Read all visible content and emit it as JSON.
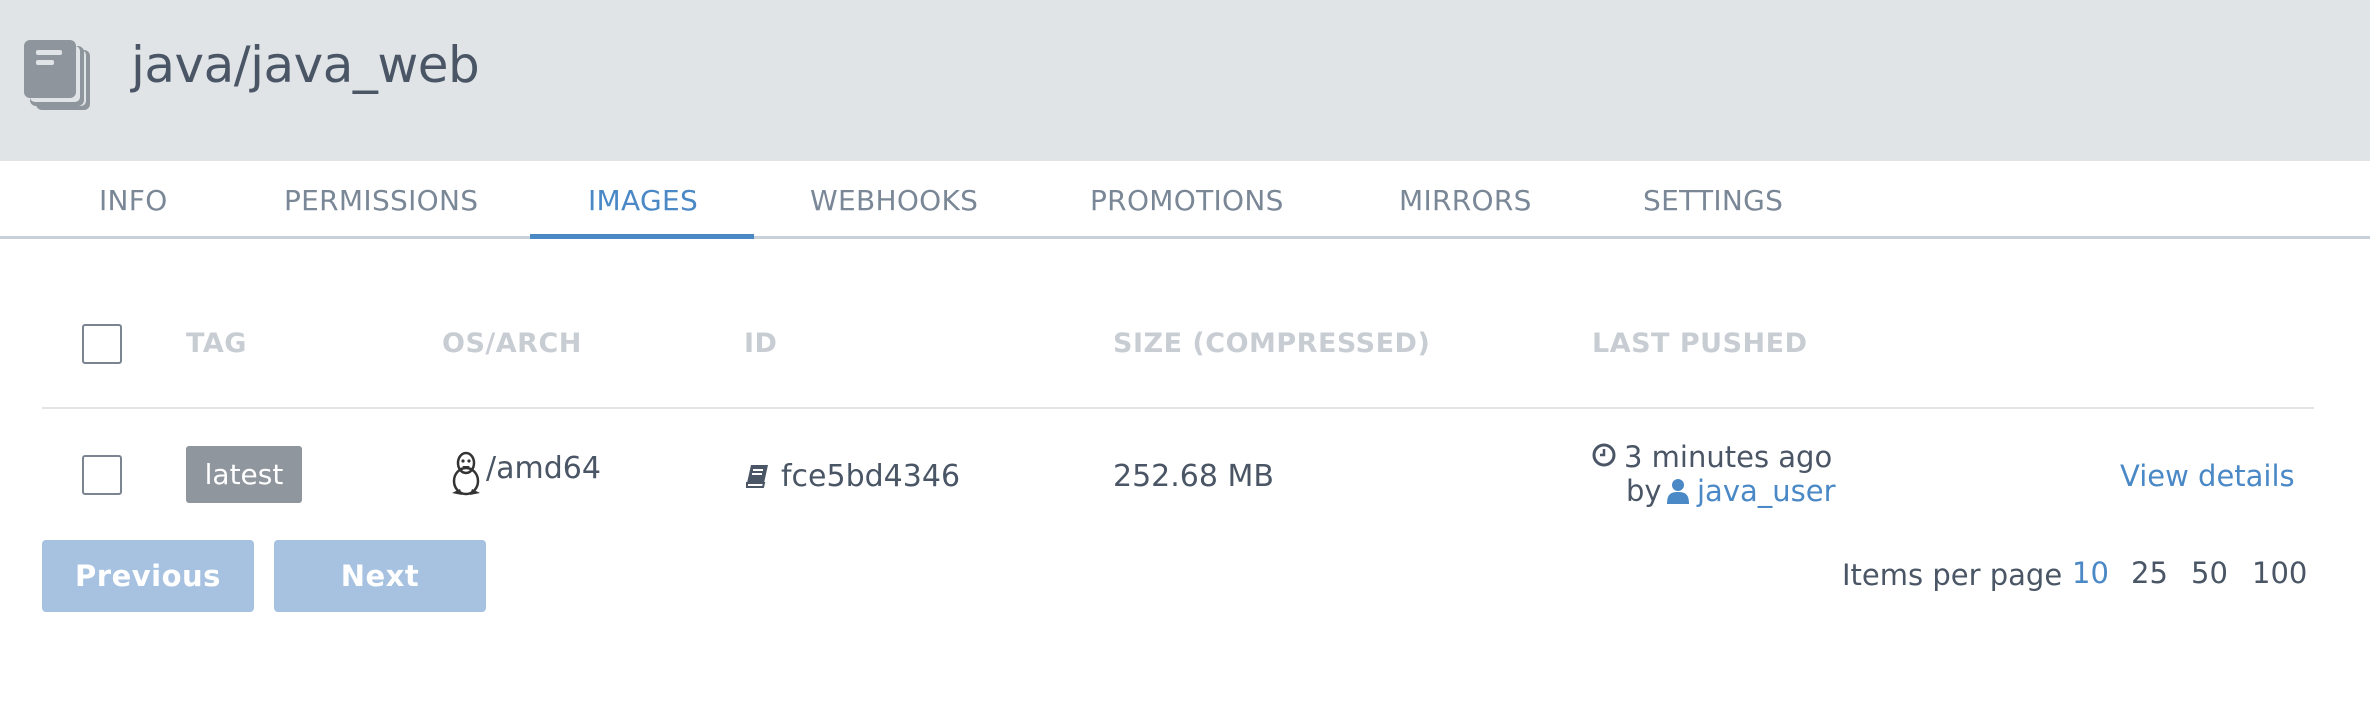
{
  "header": {
    "title": "java/java_web",
    "icon": "books-stack-icon"
  },
  "tabs": [
    {
      "label": "INFO"
    },
    {
      "label": "PERMISSIONS"
    },
    {
      "label": "IMAGES",
      "active": true
    },
    {
      "label": "WEBHOOKS"
    },
    {
      "label": "PROMOTIONS"
    },
    {
      "label": "MIRRORS"
    },
    {
      "label": "SETTINGS"
    }
  ],
  "table": {
    "columns": [
      "TAG",
      "OS/ARCH",
      "ID",
      "SIZE (COMPRESSED)",
      "LAST PUSHED"
    ],
    "rows": [
      {
        "tag": "latest",
        "os_arch": "/amd64",
        "os_icon": "linux-tux-icon",
        "id": "fce5bd4346",
        "id_icon": "book-icon",
        "size": "252.68 MB",
        "last_pushed": "3 minutes ago",
        "by_label": "by",
        "user": "java_user",
        "details_label": "View details"
      }
    ]
  },
  "pagination": {
    "previous_label": "Previous",
    "next_label": "Next",
    "items_per_page_label": "Items per page",
    "options": [
      "10",
      "25",
      "50",
      "100"
    ],
    "selected": "10"
  },
  "colors": {
    "header_bg": "#e1e4e7",
    "accent": "#4a88c6",
    "button_disabled": "#a7c2e1",
    "badge": "#8f969d"
  }
}
